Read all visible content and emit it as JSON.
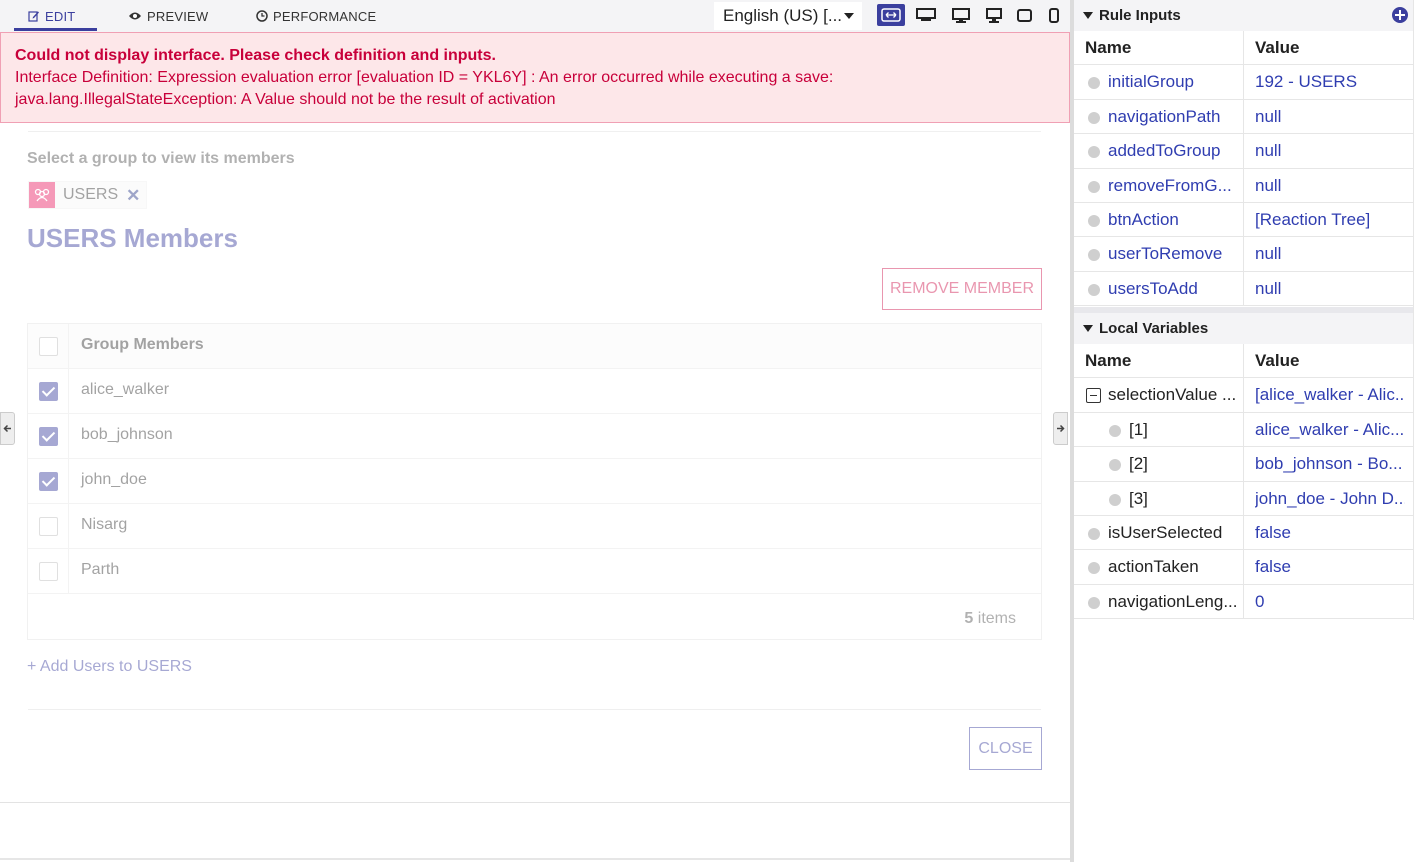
{
  "tabs": {
    "edit": "EDIT",
    "preview": "PREVIEW",
    "performance": "PERFORMANCE"
  },
  "locale": {
    "selected": "English (US) [..."
  },
  "error": {
    "title": "Could not display interface. Please check definition and inputs.",
    "line1": "Interface Definition: Expression evaluation error [evaluation ID = YKL6Y] : An error occurred while executing a save:",
    "line2": "java.lang.IllegalStateException: A Value should not be the result of activation"
  },
  "interface": {
    "group_label": "Select a group to view its members",
    "group_token": "USERS",
    "group_remove": "✕",
    "heading": "USERS Members",
    "remove_member": "REMOVE MEMBER",
    "grid": {
      "header": "Group Members",
      "rows": [
        {
          "name": "alice_walker",
          "checked": true
        },
        {
          "name": "bob_johnson",
          "checked": true
        },
        {
          "name": "john_doe",
          "checked": true
        },
        {
          "name": "Nisarg",
          "checked": false
        },
        {
          "name": "Parth",
          "checked": false
        }
      ],
      "count": "5",
      "count_label": "items"
    },
    "add_users": "+ Add Users to USERS",
    "close": "CLOSE"
  },
  "rule_inputs": {
    "title": "Rule Inputs",
    "col_name": "Name",
    "col_value": "Value",
    "rows": [
      {
        "name": "initialGroup",
        "value": "192 - USERS"
      },
      {
        "name": "navigationPath",
        "value": "null"
      },
      {
        "name": "addedToGroup",
        "value": "null"
      },
      {
        "name": "removeFromG...",
        "value": "null"
      },
      {
        "name": "btnAction",
        "value": "[Reaction Tree]"
      },
      {
        "name": "userToRemove",
        "value": "null"
      },
      {
        "name": "usersToAdd",
        "value": "null"
      }
    ]
  },
  "local_variables": {
    "title": "Local Variables",
    "col_name": "Name",
    "col_value": "Value",
    "selection": {
      "name": "selectionValue ...",
      "value": "[alice_walker - Alic..."
    },
    "children": [
      {
        "name": "[1]",
        "value": "alice_walker - Alic..."
      },
      {
        "name": "[2]",
        "value": "bob_johnson - Bo..."
      },
      {
        "name": "[3]",
        "value": "john_doe - John D..."
      }
    ],
    "rows": [
      {
        "name": "isUserSelected",
        "value": "false"
      },
      {
        "name": "actionTaken",
        "value": "false"
      },
      {
        "name": "navigationLeng...",
        "value": "0"
      }
    ]
  },
  "colors": {
    "accent": "#3b3f9e",
    "error": "#c8003a",
    "error_bg": "#fde7e9",
    "link": "#2f3db0",
    "danger": "#d0194f"
  }
}
